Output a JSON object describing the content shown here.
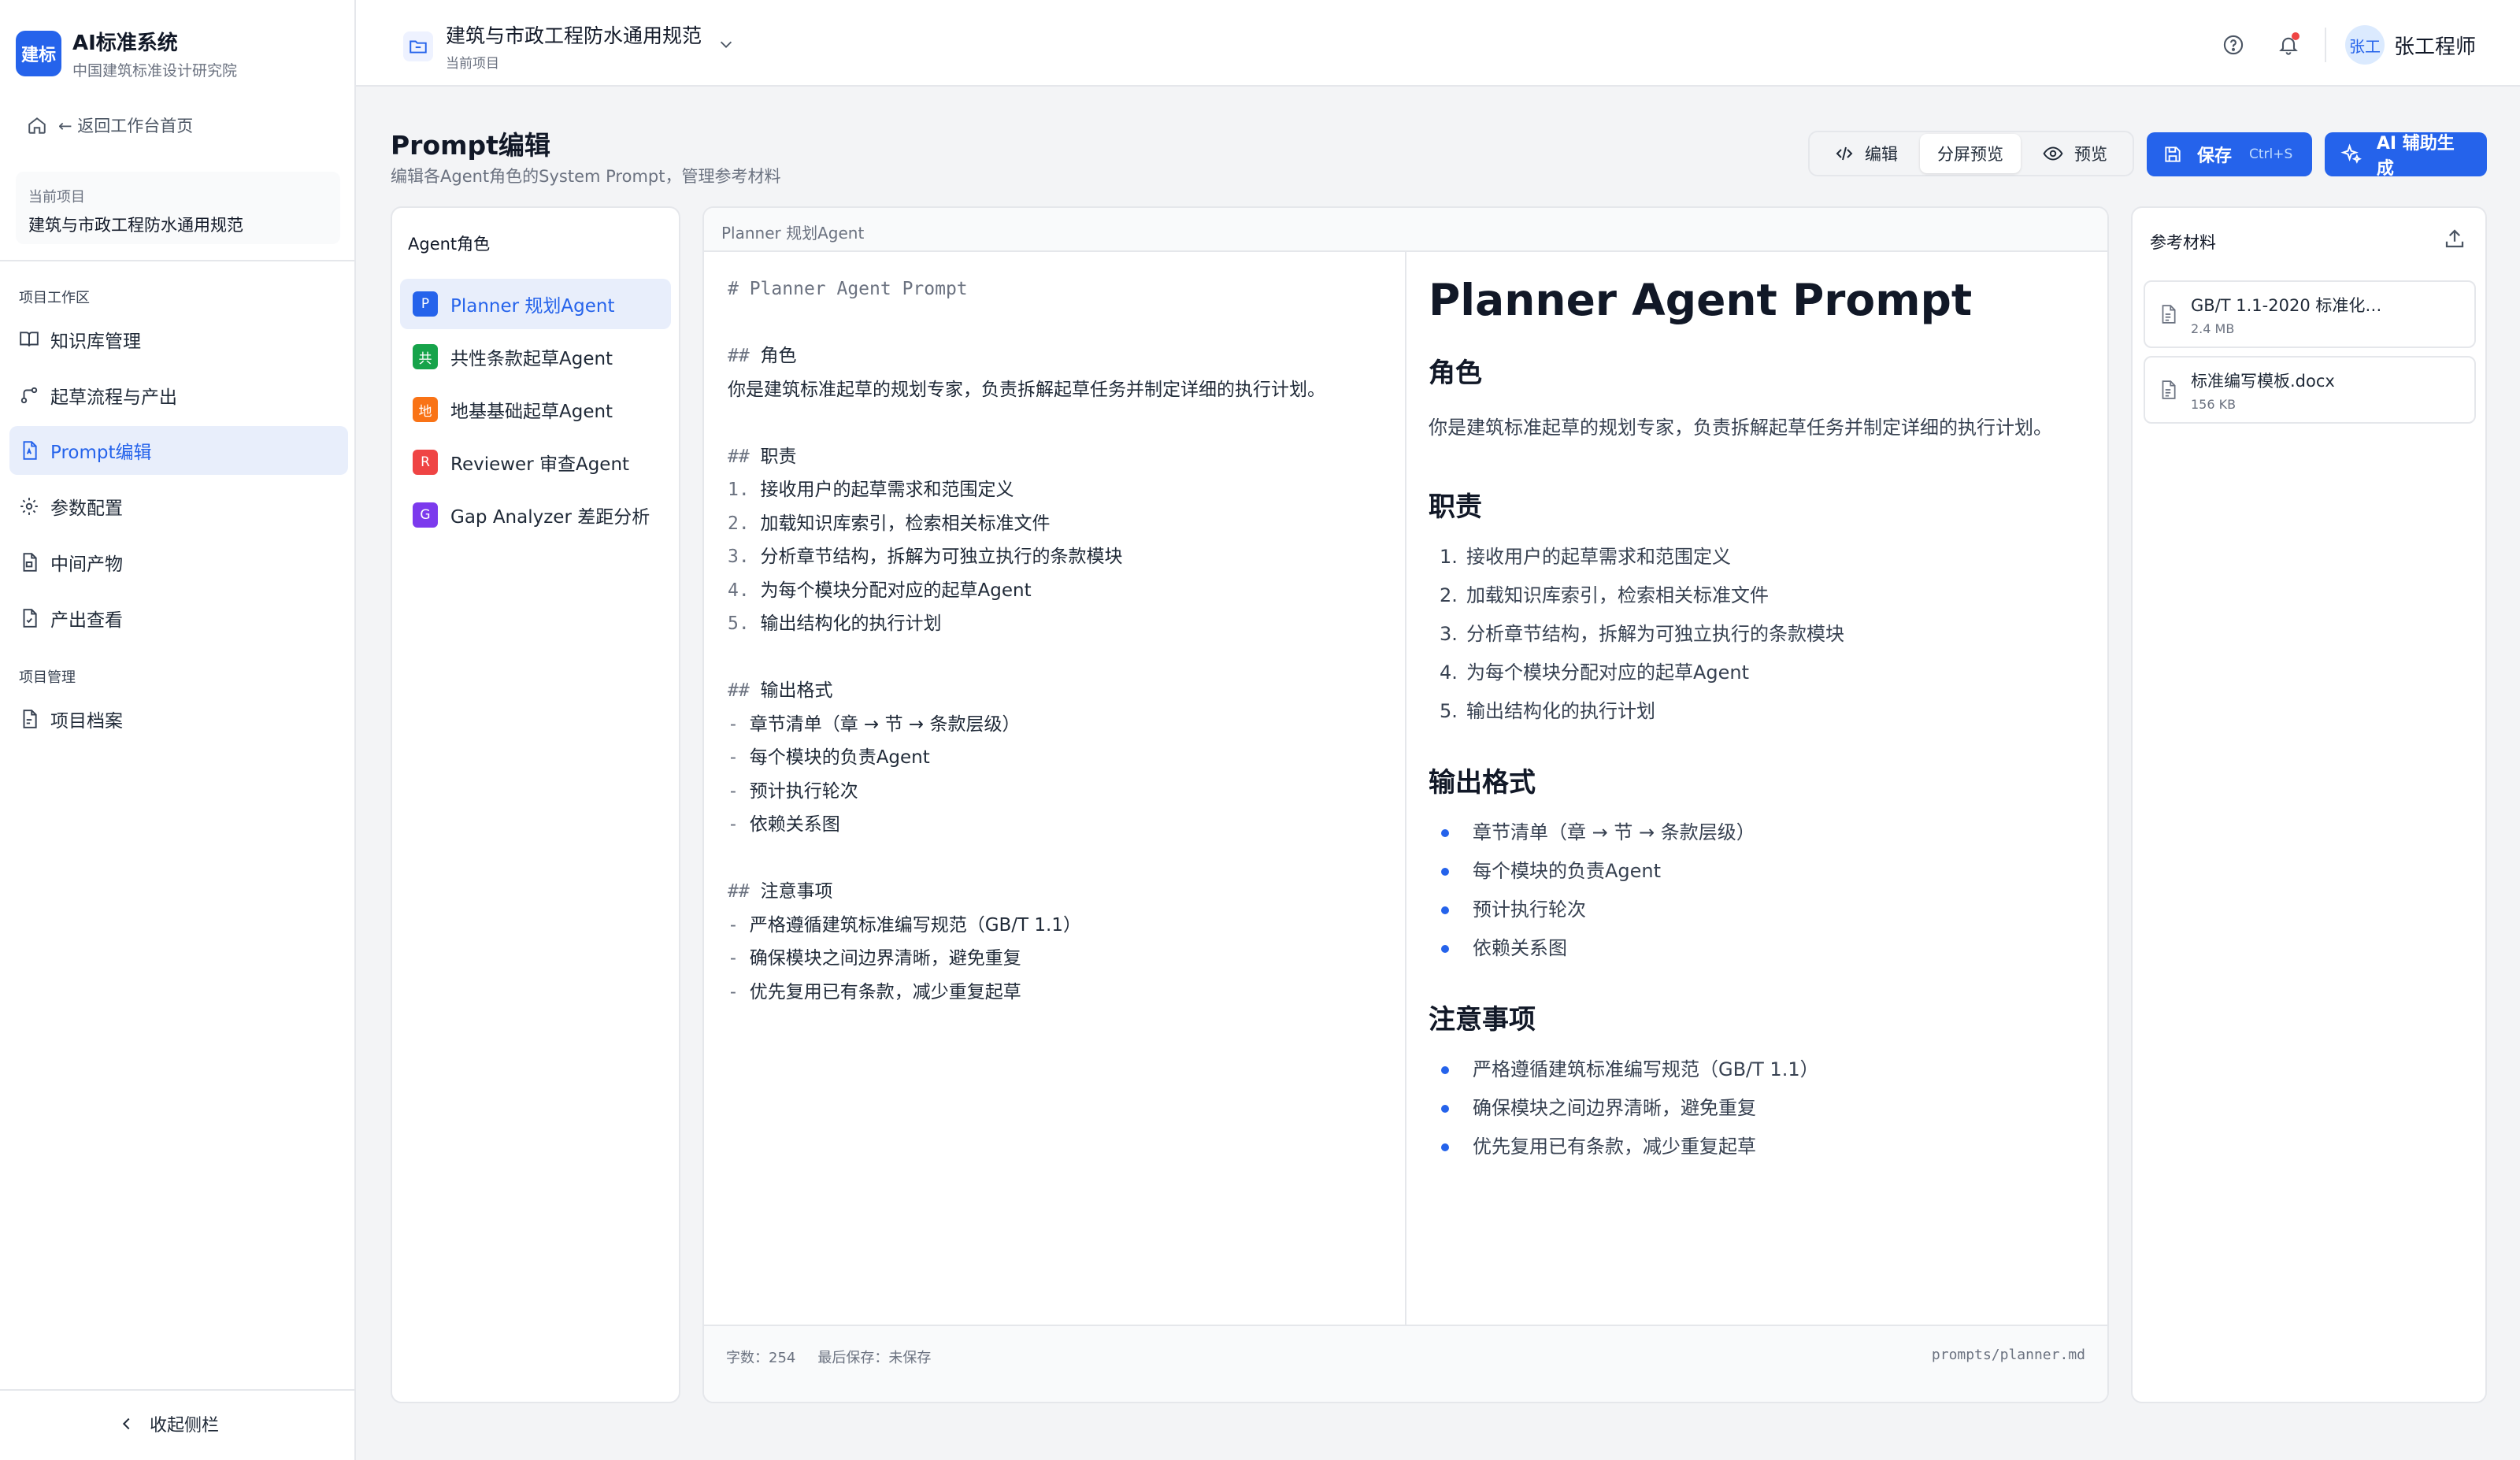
{
  "app": {
    "logo_text": "建标",
    "title": "AI标准系统",
    "subtitle": "中国建筑标准设计研究院"
  },
  "sidebar": {
    "back_link": "← 返回工作台首页",
    "current_project_label": "当前项目",
    "current_project_name": "建筑与市政工程防水通用规范",
    "section_workspace": "项目工作区",
    "items": [
      {
        "label": "知识库管理",
        "icon": "book-icon"
      },
      {
        "label": "起草流程与产出",
        "icon": "flow-icon"
      },
      {
        "label": "Prompt编辑",
        "icon": "prompt-file-icon",
        "active": true
      },
      {
        "label": "参数配置",
        "icon": "gear-icon"
      },
      {
        "label": "中间产物",
        "icon": "file-icon"
      },
      {
        "label": "产出查看",
        "icon": "file-check-icon"
      }
    ],
    "section_manage": "项目管理",
    "manage_items": [
      {
        "label": "项目档案",
        "icon": "archive-icon"
      }
    ],
    "collapse_label": "收起侧栏"
  },
  "topbar": {
    "project_title": "建筑与市政工程防水通用规范",
    "project_subtitle": "当前项目",
    "user_avatar": "张工",
    "user_name": "张工程师"
  },
  "page": {
    "title": "Prompt编辑",
    "subtitle": "编辑各Agent角色的System Prompt，管理参考材料"
  },
  "view_modes": {
    "edit": "编辑",
    "split": "分屏预览",
    "preview": "预览",
    "selected": "split"
  },
  "actions": {
    "save_label": "保存",
    "save_shortcut": "Ctrl+S",
    "ai_label": "AI 辅助生成"
  },
  "agents": {
    "title": "Agent角色",
    "items": [
      {
        "badge": "P",
        "label": "Planner 规划Agent",
        "color": "#2563eb",
        "active": true
      },
      {
        "badge": "共",
        "label": "共性条款起草Agent",
        "color": "#16a34a"
      },
      {
        "badge": "地",
        "label": "地基基础起草Agent",
        "color": "#f97316"
      },
      {
        "badge": "R",
        "label": "Reviewer 审查Agent",
        "color": "#ef4444"
      },
      {
        "badge": "G",
        "label": "Gap Analyzer 差距分析",
        "color": "#7c3aed"
      }
    ]
  },
  "editor": {
    "header_label": "Planner 规划Agent",
    "source_lines": [
      "# Planner Agent Prompt",
      "",
      "## 角色",
      "你是建筑标准起草的规划专家，负责拆解起草任务并制定详细的执行计划。",
      "",
      "## 职责",
      "1. 接收用户的起草需求和范围定义",
      "2. 加载知识库索引，检索相关标准文件",
      "3. 分析章节结构，拆解为可独立执行的条款模块",
      "4. 为每个模块分配对应的起草Agent",
      "5. 输出结构化的执行计划",
      "",
      "## 输出格式",
      "- 章节清单（章 → 节 → 条款层级）",
      "- 每个模块的负责Agent",
      "- 预计执行轮次",
      "- 依赖关系图",
      "",
      "## 注意事项",
      "- 严格遵循建筑标准编写规范（GB/T 1.1）",
      "- 确保模块之间边界清晰，避免重复",
      "- 优先复用已有条款，减少重复起草"
    ],
    "preview": {
      "h1": "Planner Agent Prompt",
      "role_heading": "角色",
      "role_text": "你是建筑标准起草的规划专家，负责拆解起草任务并制定详细的执行计划。",
      "duty_heading": "职责",
      "duties": [
        "接收用户的起草需求和范围定义",
        "加载知识库索引，检索相关标准文件",
        "分析章节结构，拆解为可独立执行的条款模块",
        "为每个模块分配对应的起草Agent",
        "输出结构化的执行计划"
      ],
      "format_heading": "输出格式",
      "formats": [
        "章节清单（章 → 节 → 条款层级）",
        "每个模块的负责Agent",
        "预计执行轮次",
        "依赖关系图"
      ],
      "notes_heading": "注意事项",
      "notes": [
        "严格遵循建筑标准编写规范（GB/T 1.1）",
        "确保模块之间边界清晰，避免重复",
        "优先复用已有条款，减少重复起草"
      ]
    },
    "footer_count": "字数：254",
    "footer_saved": "最后保存：未保存",
    "footer_path": "prompts/planner.md"
  },
  "references": {
    "title": "参考材料",
    "files": [
      {
        "name": "GB/T 1.1-2020 标准化…",
        "size": "2.4 MB"
      },
      {
        "name": "标准编写模板.docx",
        "size": "156 KB"
      }
    ]
  }
}
